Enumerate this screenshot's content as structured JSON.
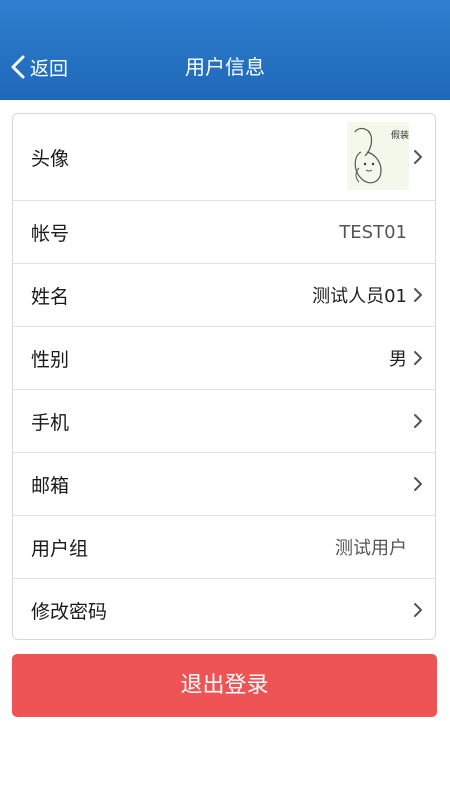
{
  "header": {
    "back_label": "返回",
    "title": "用户信息"
  },
  "rows": [
    {
      "label": "头像",
      "value": "",
      "chevron": true
    },
    {
      "label": "帐号",
      "value": "TEST01",
      "chevron": false
    },
    {
      "label": "姓名",
      "value": "测试人员01",
      "chevron": true
    },
    {
      "label": "性别",
      "value": "男",
      "chevron": true
    },
    {
      "label": "手机",
      "value": "",
      "chevron": true
    },
    {
      "label": "邮箱",
      "value": "",
      "chevron": true
    },
    {
      "label": "用户组",
      "value": "测试用户",
      "chevron": false
    },
    {
      "label": "修改密码",
      "value": "",
      "chevron": true
    }
  ],
  "avatar_text": "假装我咯",
  "logout_label": "退出登录",
  "colors": {
    "header": "#1f68b8",
    "logout": "#ee5455"
  },
  "icons": {
    "back": "chevron-left-icon",
    "row_arrow": "chevron-right-icon"
  }
}
